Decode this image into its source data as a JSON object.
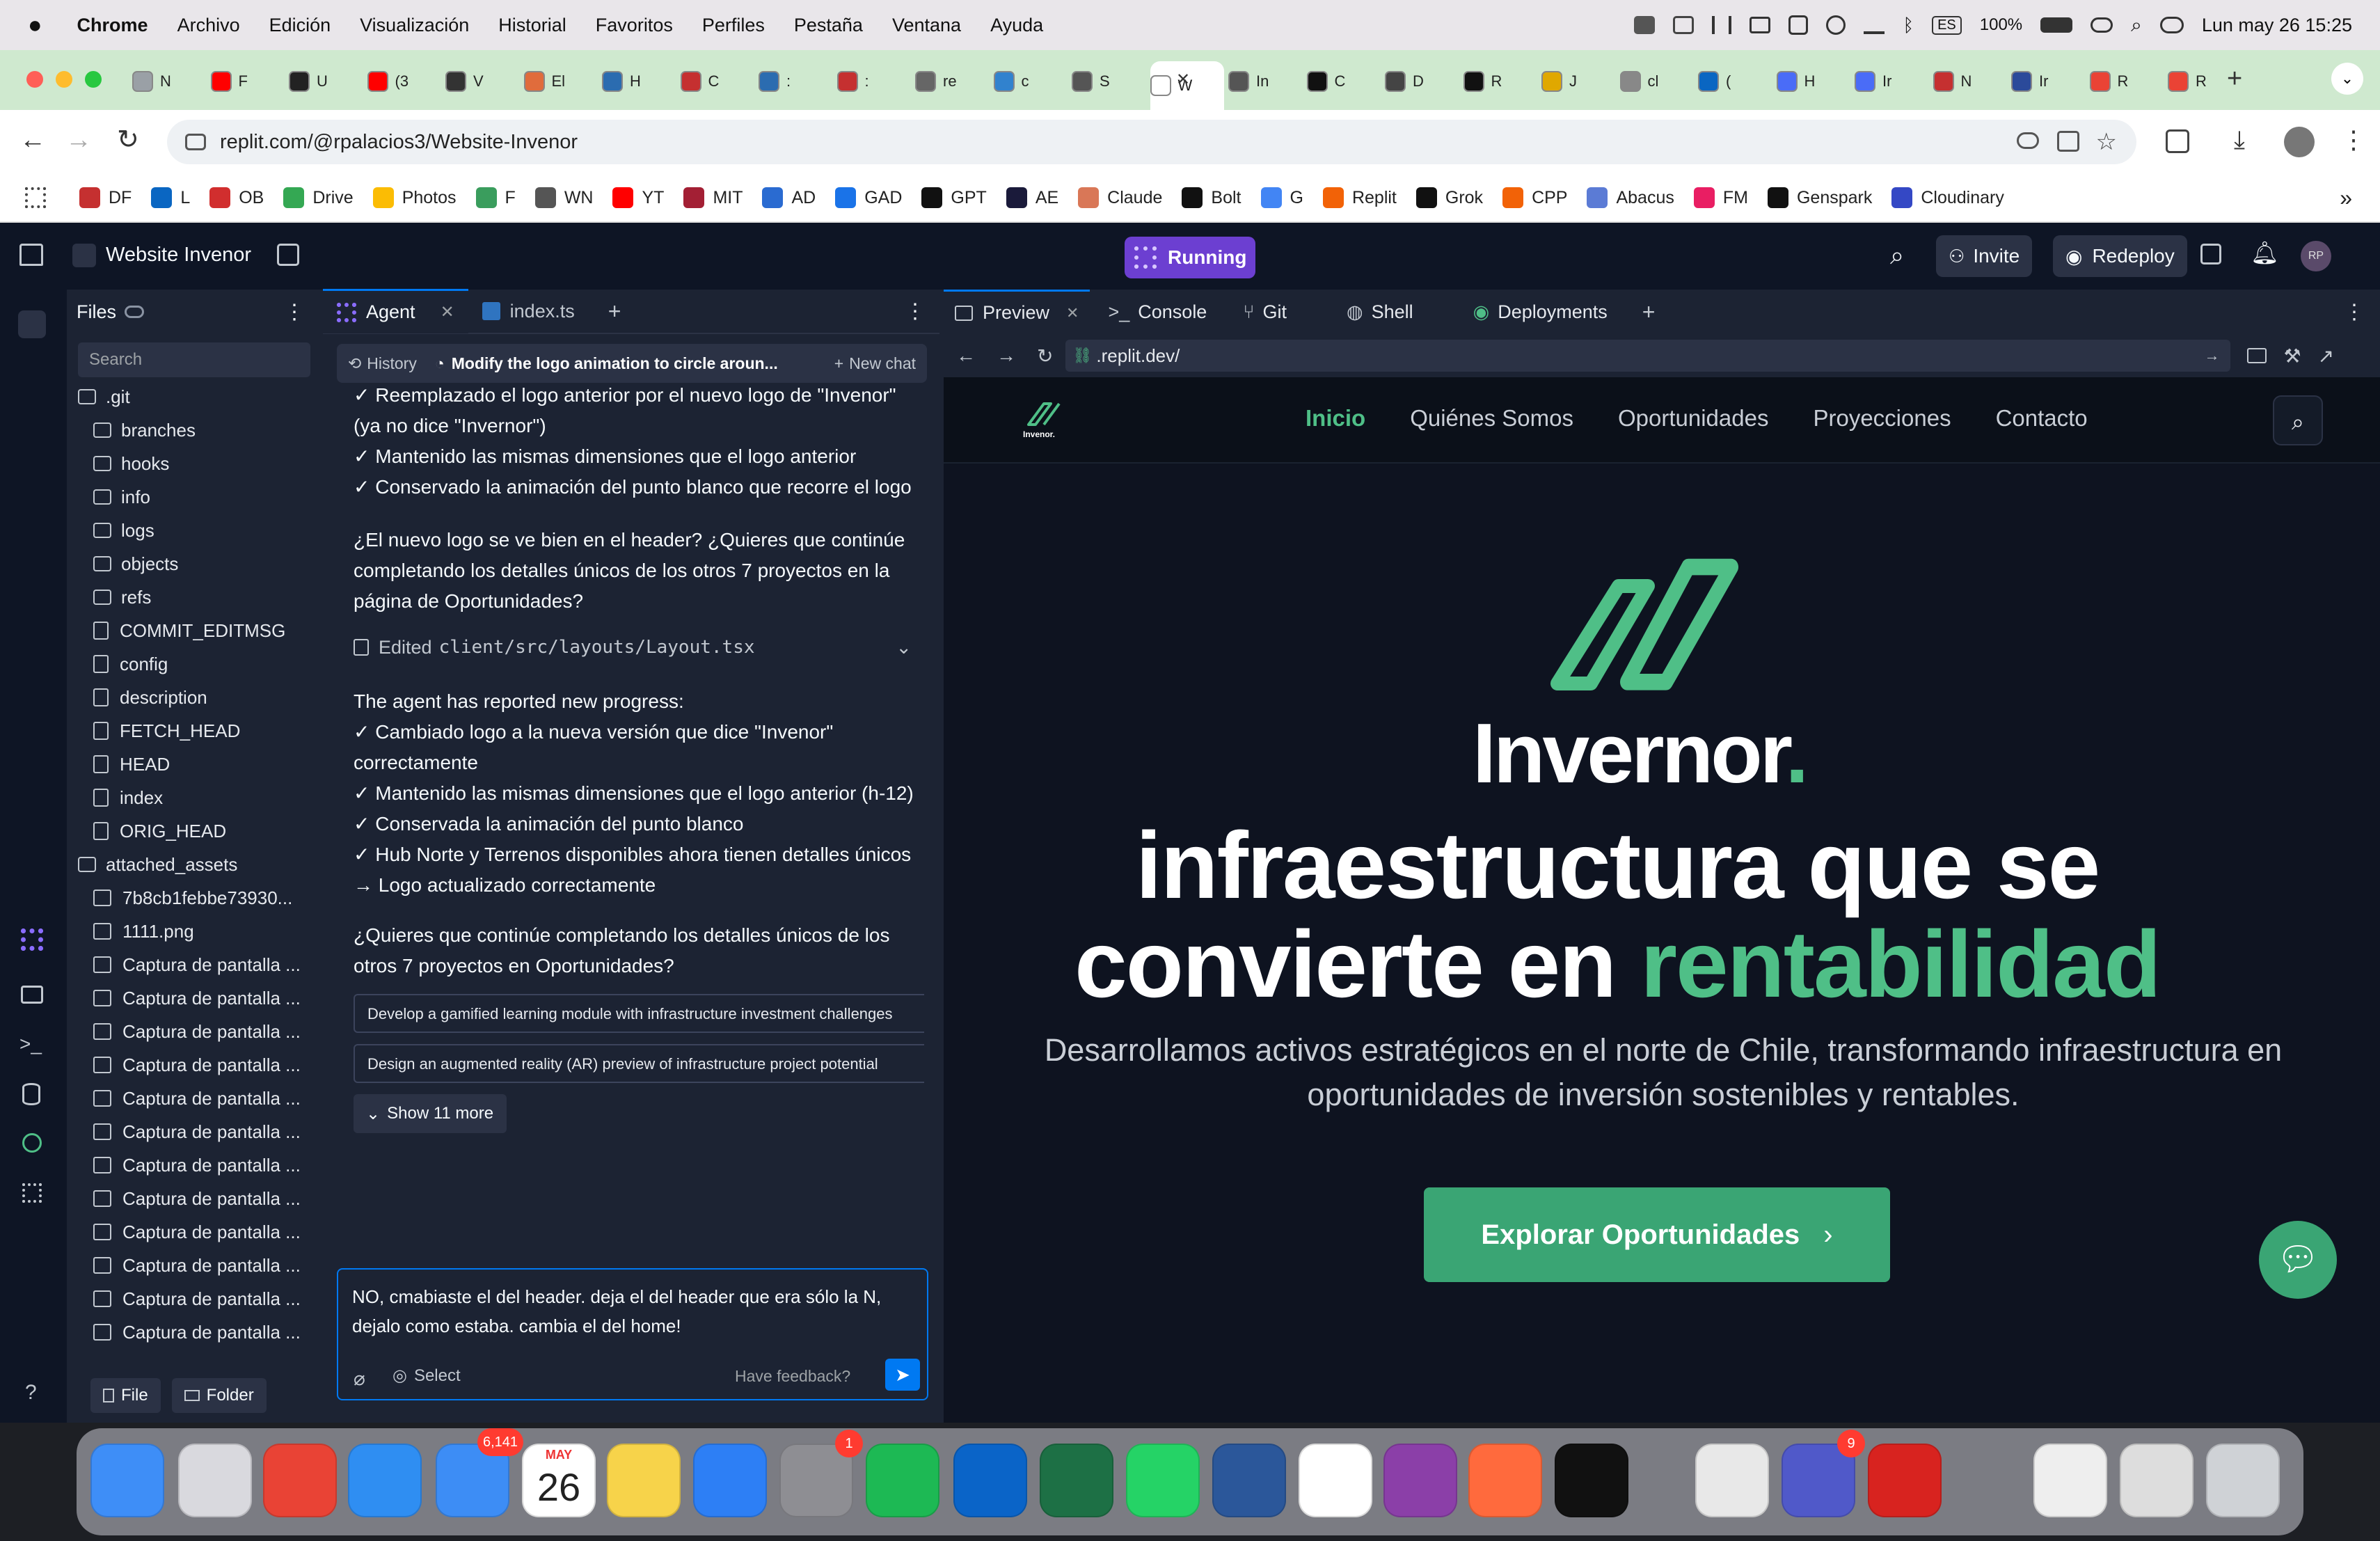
{
  "menubar": {
    "app": "Chrome",
    "items": [
      "Archivo",
      "Edición",
      "Visualización",
      "Historial",
      "Favoritos",
      "Perfiles",
      "Pestaña",
      "Ventana",
      "Ayuda"
    ],
    "battery": "100%",
    "lang": "ES",
    "datetime": "Lun may 26  15:25"
  },
  "tabs": [
    {
      "label": "N",
      "color": "#9aa0a6"
    },
    {
      "label": "F",
      "color": "#ff0000"
    },
    {
      "label": "U",
      "color": "#222"
    },
    {
      "label": "(3",
      "color": "#ff0000"
    },
    {
      "label": "V",
      "color": "#333"
    },
    {
      "label": "El",
      "color": "#e06c3c"
    },
    {
      "label": "H",
      "color": "#2b6cb0"
    },
    {
      "label": "C",
      "color": "#c53030"
    },
    {
      "label": ":",
      "color": "#2b6cb0"
    },
    {
      "label": ":",
      "color": "#c53030"
    },
    {
      "label": "re",
      "color": "#666"
    },
    {
      "label": "c",
      "color": "#3182ce"
    },
    {
      "label": "S",
      "color": "#555"
    },
    {
      "label": "W",
      "color": "#fff"
    },
    {
      "label": "In",
      "color": "#555"
    },
    {
      "label": "C",
      "color": "#111"
    },
    {
      "label": "D",
      "color": "#444"
    },
    {
      "label": "R",
      "color": "#111"
    },
    {
      "label": "J",
      "color": "#e0a800"
    },
    {
      "label": "cl",
      "color": "#888"
    },
    {
      "label": "(",
      "color": "#0a66c2"
    },
    {
      "label": "H",
      "color": "#4a6cf7"
    },
    {
      "label": "Ir",
      "color": "#4a6cf7"
    },
    {
      "label": "N",
      "color": "#c53030"
    },
    {
      "label": "Ir",
      "color": "#2b4a9a"
    },
    {
      "label": "R",
      "color": "#ea4335"
    },
    {
      "label": "R",
      "color": "#ea4335"
    }
  ],
  "address": {
    "url": "replit.com/@rpalacios3/Website-Invenor"
  },
  "bookmarks": [
    {
      "label": "DF",
      "color": "#c53030"
    },
    {
      "label": "L",
      "color": "#0a66c2"
    },
    {
      "label": "OB",
      "color": "#d12e2e"
    },
    {
      "label": "Drive",
      "color": "#34a853"
    },
    {
      "label": "Photos",
      "color": "#fbbc04"
    },
    {
      "label": "F",
      "color": "#3a9d5d"
    },
    {
      "label": "WN",
      "color": "#555"
    },
    {
      "label": "YT",
      "color": "#ff0000"
    },
    {
      "label": "MIT",
      "color": "#a31f34"
    },
    {
      "label": "AD",
      "color": "#2a6bd1"
    },
    {
      "label": "GAD",
      "color": "#1a73e8"
    },
    {
      "label": "GPT",
      "color": "#111"
    },
    {
      "label": "AE",
      "color": "#1a1a3a"
    },
    {
      "label": "Claude",
      "color": "#d97757"
    },
    {
      "label": "Bolt",
      "color": "#111"
    },
    {
      "label": "G",
      "color": "#4285f4"
    },
    {
      "label": "Replit",
      "color": "#f26207"
    },
    {
      "label": "Grok",
      "color": "#111"
    },
    {
      "label": "CPP",
      "color": "#f26207"
    },
    {
      "label": "Abacus",
      "color": "#5b7bd5"
    },
    {
      "label": "FM",
      "color": "#e91e63"
    },
    {
      "label": "Genspark",
      "color": "#111"
    },
    {
      "label": "Cloudinary",
      "color": "#3448c5"
    }
  ],
  "replit": {
    "project": "Website Invenor",
    "status": "Running",
    "invite": "Invite",
    "redeploy": "Redeploy",
    "avatar": "RP"
  },
  "files": {
    "title": "Files",
    "search": "Search",
    "file_btn": "File",
    "folder_btn": "Folder",
    "tree": [
      {
        "name": ".git",
        "type": "folder",
        "indent": 0
      },
      {
        "name": "branches",
        "type": "folder",
        "indent": 1
      },
      {
        "name": "hooks",
        "type": "folder",
        "indent": 1
      },
      {
        "name": "info",
        "type": "folder",
        "indent": 1
      },
      {
        "name": "logs",
        "type": "folder",
        "indent": 1
      },
      {
        "name": "objects",
        "type": "folder",
        "indent": 1
      },
      {
        "name": "refs",
        "type": "folder",
        "indent": 1
      },
      {
        "name": "COMMIT_EDITMSG",
        "type": "file",
        "indent": 1
      },
      {
        "name": "config",
        "type": "file",
        "indent": 1
      },
      {
        "name": "description",
        "type": "file",
        "indent": 1
      },
      {
        "name": "FETCH_HEAD",
        "type": "file",
        "indent": 1
      },
      {
        "name": "HEAD",
        "type": "file",
        "indent": 1
      },
      {
        "name": "index",
        "type": "file",
        "indent": 1
      },
      {
        "name": "ORIG_HEAD",
        "type": "file",
        "indent": 1
      },
      {
        "name": "attached_assets",
        "type": "folder",
        "indent": 0
      },
      {
        "name": "7b8cb1febbe73930...",
        "type": "image",
        "indent": 1
      },
      {
        "name": "1111.png",
        "type": "image",
        "indent": 1
      },
      {
        "name": "Captura de pantalla ...",
        "type": "image",
        "indent": 1
      },
      {
        "name": "Captura de pantalla ...",
        "type": "image",
        "indent": 1
      },
      {
        "name": "Captura de pantalla ...",
        "type": "image",
        "indent": 1
      },
      {
        "name": "Captura de pantalla ...",
        "type": "image",
        "indent": 1
      },
      {
        "name": "Captura de pantalla ...",
        "type": "image",
        "indent": 1
      },
      {
        "name": "Captura de pantalla ...",
        "type": "image",
        "indent": 1
      },
      {
        "name": "Captura de pantalla ...",
        "type": "image",
        "indent": 1
      },
      {
        "name": "Captura de pantalla ...",
        "type": "image",
        "indent": 1
      },
      {
        "name": "Captura de pantalla ...",
        "type": "image",
        "indent": 1
      },
      {
        "name": "Captura de pantalla ...",
        "type": "image",
        "indent": 1
      },
      {
        "name": "Captura de pantalla ...",
        "type": "image",
        "indent": 1
      },
      {
        "name": "Captura de pantalla ...",
        "type": "image",
        "indent": 1
      },
      {
        "name": "Captura de pantalla ...",
        "type": "image",
        "indent": 1
      }
    ]
  },
  "agent": {
    "tab_agent": "Agent",
    "tab_file": "index.ts",
    "history": "History",
    "chat_title": "Modify the logo animation to circle aroun...",
    "new_chat": "New chat",
    "block1": [
      "✓ Reemplazado el logo anterior por el nuevo logo de \"Invenor\" (ya no dice \"Invernor\")",
      "✓ Mantenido las mismas dimensiones que el logo anterior",
      "✓ Conservado la animación del punto blanco que recorre el logo"
    ],
    "question1": "¿El nuevo logo se ve bien en el header? ¿Quieres que continúe completando los detalles únicos de los otros 7 proyectos en la página de Oportunidades?",
    "edited_prefix": "Edited",
    "edited_file": "client/src/layouts/Layout.tsx",
    "progress_title": "The agent has reported new progress:",
    "block2": [
      "✓ Cambiado logo a la nueva versión que dice \"Invenor\" correctamente",
      "✓ Mantenido las mismas dimensiones que el logo anterior (h-12)",
      "✓ Conservada la animación del punto blanco",
      "✓ Hub Norte y Terrenos disponibles ahora tienen detalles únicos",
      "→ Logo actualizado correctamente"
    ],
    "question2": "¿Quieres que continúe completando los detalles únicos de los otros 7 proyectos en Oportunidades?",
    "suggestions": [
      "Develop a gamified learning module with infrastructure investment challenges",
      "Design an augmented reality (AR) preview of infrastructure project potential"
    ],
    "show_more": "Show 11 more",
    "input": "NO, cmabiaste el del header. deja el del header que era sólo la N, dejalo como estaba. cambia el del home!",
    "select": "Select",
    "feedback": "Have feedback?"
  },
  "preview": {
    "tabs": [
      "Preview",
      "Console",
      "Git",
      "Shell",
      "Deployments"
    ],
    "url": ".replit.dev/",
    "site": {
      "logo_small": "Invenor.",
      "nav": [
        "Inicio",
        "Quiénes Somos",
        "Oportunidades",
        "Proyecciones",
        "Contacto"
      ],
      "wordmark": "Invernor",
      "wordmark_dot": ".",
      "headline1": "infraestructura que se",
      "headline2a": "convierte en ",
      "headline2b": "rentabilidad",
      "sub": "Desarrollamos activos estratégicos en el norte de Chile, transformando infraestructura en oportunidades de inversión sostenibles y rentables.",
      "cta": "Explorar Oportunidades",
      "accent": "#4fbf87"
    }
  },
  "dock": {
    "mail_badge": "6,141",
    "cal_month": "MAY",
    "cal_day": "26",
    "settings_badge": "1",
    "teams_badge": "9"
  }
}
